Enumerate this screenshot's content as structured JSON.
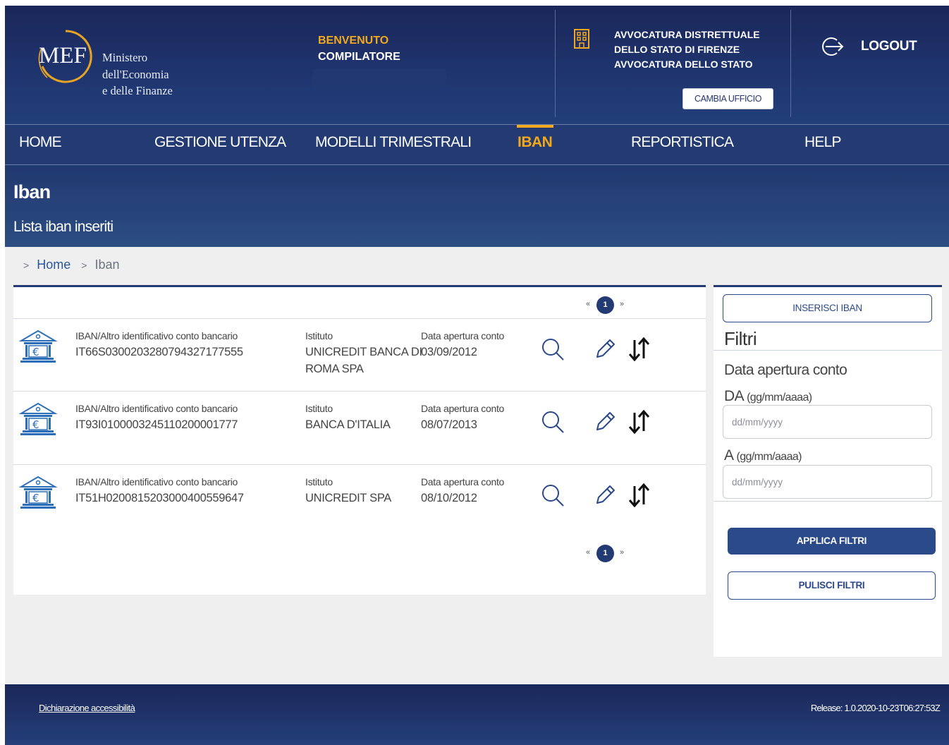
{
  "header": {
    "logo": {
      "mark": "MEF",
      "lines": [
        "Ministero",
        "dell'Economia",
        "e delle Finanze"
      ]
    },
    "welcome_label": "BENVENUTO",
    "role": "COMPILATORE",
    "office": "AVVOCATURA DISTRETTUALE DELLO STATO DI FIRENZE AVVOCATURA DELLO STATO",
    "change_office_label": "CAMBIA UFFICIO",
    "logout_label": "LOGOUT"
  },
  "nav": {
    "items": [
      {
        "label": "HOME",
        "active": false
      },
      {
        "label": "GESTIONE UTENZA",
        "active": false
      },
      {
        "label": "MODELLI TRIMESTRALI",
        "active": false
      },
      {
        "label": "IBAN",
        "active": true
      },
      {
        "label": "REPORTISTICA",
        "active": false
      },
      {
        "label": "HELP",
        "active": false
      }
    ]
  },
  "page": {
    "title": "Iban",
    "subtitle": "Lista iban inseriti"
  },
  "breadcrumb": {
    "separator": ">",
    "items": [
      "Home",
      "Iban"
    ]
  },
  "list": {
    "pagination": {
      "current": "1",
      "prev": "«",
      "next": "»"
    },
    "labels": {
      "iban": "IBAN/Altro identificativo conto bancario",
      "istituto": "Istituto",
      "data": "Data apertura conto"
    },
    "rows": [
      {
        "iban": "IT66S0300203280794327177555",
        "istituto": "UNICREDIT BANCA DI ROMA SPA",
        "data": "03/09/2012"
      },
      {
        "iban": "IT93I0100003245110200001777",
        "istituto": "BANCA D'ITALIA",
        "data": "08/07/2013"
      },
      {
        "iban": "IT51H0200815203000400559647",
        "istituto": "UNICREDIT SPA",
        "data": "08/10/2012"
      }
    ],
    "icons": {
      "row": "bank-euro-icon",
      "view": "search-icon",
      "edit": "pencil-icon",
      "sort": "sort-arrows-icon"
    }
  },
  "filters": {
    "insert_label": "INSERISCI IBAN",
    "title": "Filtri",
    "section": "Data apertura conto",
    "from_label": "DA",
    "to_label": "A",
    "date_hint": "(gg/mm/aaaa)",
    "from_placeholder": "dd/mm/yyyy",
    "to_placeholder": "dd/mm/yyyy",
    "from_value": "",
    "to_value": "",
    "apply_label": "APPLICA FILTRI",
    "clear_label": "PULISCI FILTRI"
  },
  "footer": {
    "accessibility_link": "Dichiarazione accessibilità",
    "release": "Release: 1.0.2020-10-23T06:27:53Z"
  },
  "colors": {
    "header_bg": "#1b2759",
    "accent": "#f2a81d",
    "primary": "#2b4a8a",
    "page_bg": "#efefef"
  }
}
